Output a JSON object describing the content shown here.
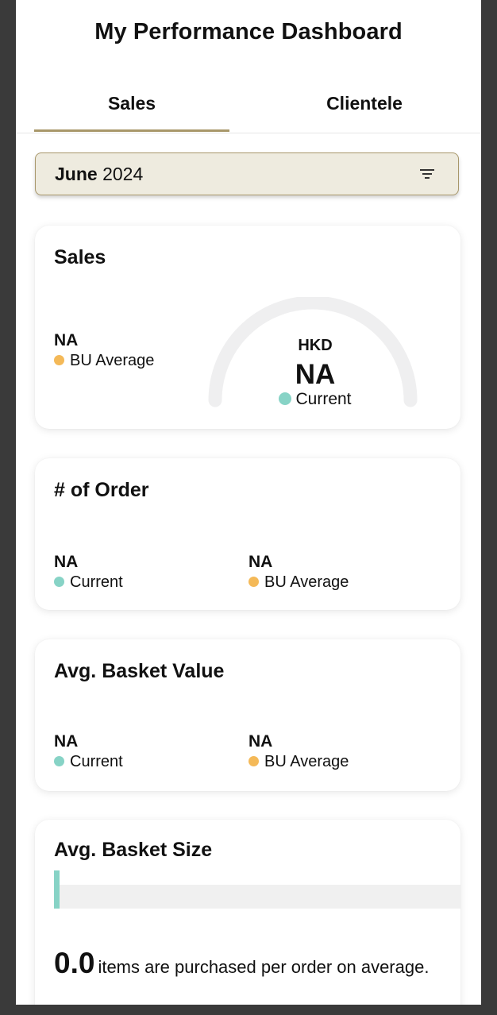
{
  "header": {
    "title": "My Performance Dashboard"
  },
  "tabs": [
    {
      "label": "Sales",
      "active": true
    },
    {
      "label": "Clientele",
      "active": false
    }
  ],
  "filter": {
    "month": "June",
    "year": "2024",
    "icon": "filter-icon"
  },
  "sales_card": {
    "title": "Sales",
    "bu_average": {
      "value": "NA",
      "label": "BU Average"
    },
    "gauge": {
      "currency": "HKD",
      "value": "NA",
      "label": "Current"
    }
  },
  "orders_card": {
    "title": "# of Order",
    "current": {
      "value": "NA",
      "label": "Current"
    },
    "bu_average": {
      "value": "NA",
      "label": "BU Average"
    }
  },
  "basket_value_card": {
    "title": "Avg. Basket Value",
    "current": {
      "value": "NA",
      "label": "Current"
    },
    "bu_average": {
      "value": "NA",
      "label": "BU Average"
    }
  },
  "basket_size_card": {
    "title": "Avg. Basket Size",
    "value": "0.0",
    "caption": "items are purchased per order on average."
  },
  "colors": {
    "accent": "#a8976a",
    "filter_bg": "#eeebdf",
    "current": "#87d3c6",
    "bu_average": "#f4b958",
    "gauge_track": "#efeff0"
  }
}
